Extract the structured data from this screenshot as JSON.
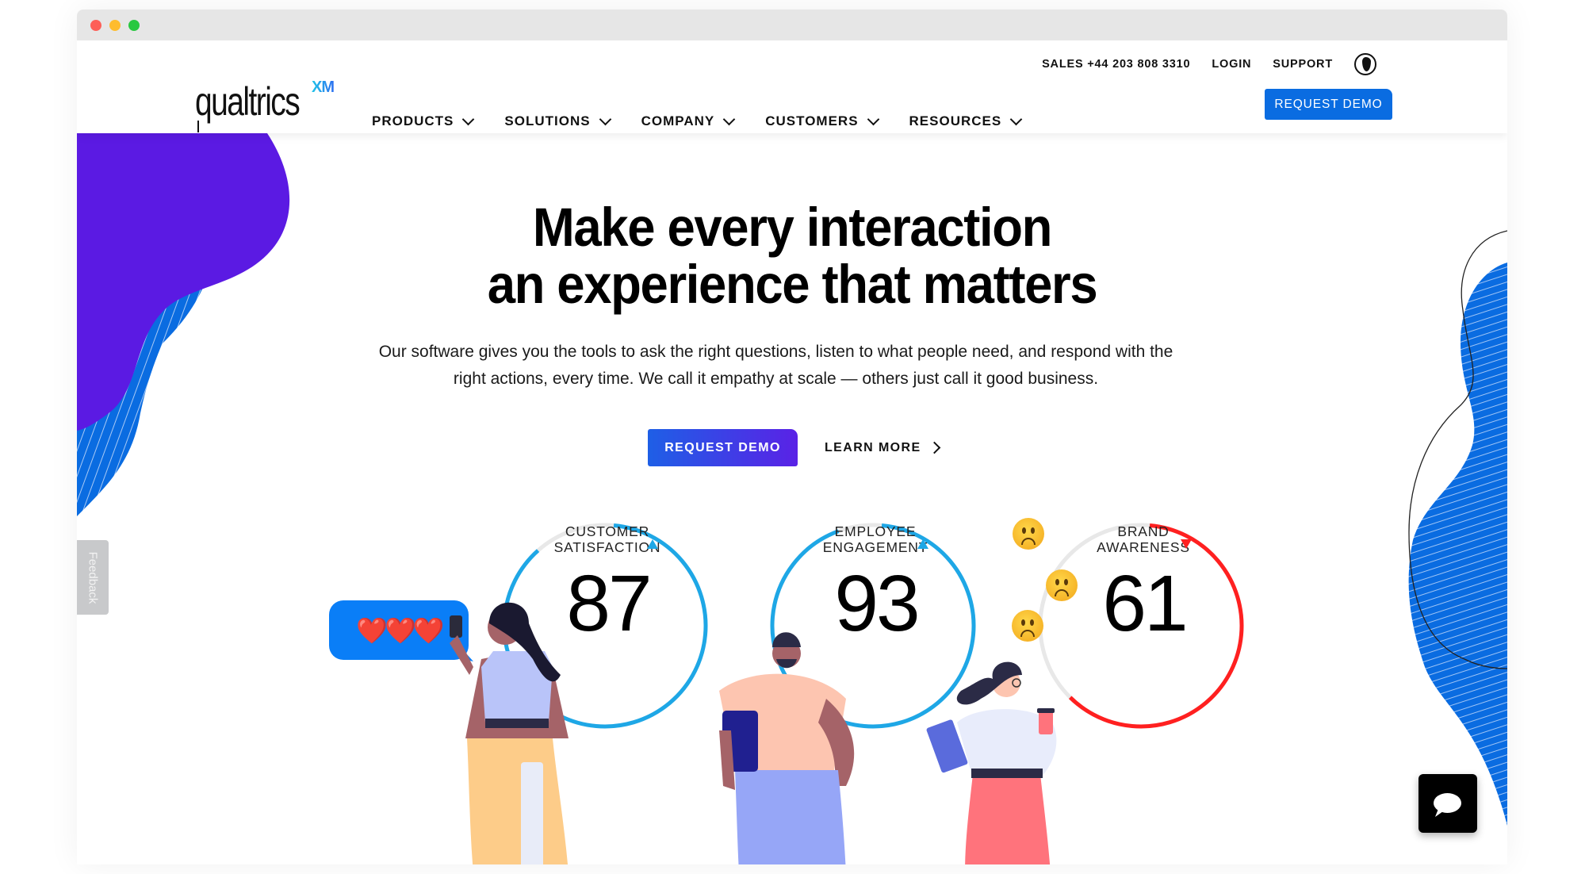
{
  "window": {
    "controls": [
      "close",
      "minimize",
      "maximize"
    ]
  },
  "header": {
    "logo_text": "qualtrics",
    "logo_badge": "XM",
    "utility_links": [
      "SALES +44 203 808 3310",
      "LOGIN",
      "SUPPORT"
    ],
    "language_icon": "globe-icon",
    "nav": [
      {
        "label": "PRODUCTS"
      },
      {
        "label": "SOLUTIONS"
      },
      {
        "label": "COMPANY"
      },
      {
        "label": "CUSTOMERS"
      },
      {
        "label": "RESOURCES"
      }
    ],
    "request_demo_label": "REQUEST DEMO",
    "accent_color": "#0a6ce1"
  },
  "hero": {
    "title_line1": "Make every interaction",
    "title_line2": "an experience that matters",
    "subtitle": "Our software gives you the tools to ask the right questions, listen to what people need, and respond with the right actions, every time. We call it empathy at scale — others just call it good business.",
    "primary_cta": "REQUEST DEMO",
    "secondary_cta": "LEARN MORE"
  },
  "metrics": [
    {
      "label_line1": "CUSTOMER",
      "label_line2": "SATISFACTION",
      "value": "87",
      "score": 87,
      "trend": "up",
      "color": "#1ea7e6"
    },
    {
      "label_line1": "EMPLOYEE",
      "label_line2": "ENGAGEMENT",
      "value": "93",
      "score": 93,
      "trend": "up",
      "color": "#1ea7e6"
    },
    {
      "label_line1": "BRAND",
      "label_line2": "AWARENESS",
      "value": "61",
      "score": 61,
      "trend": "down",
      "color": "#ff2020"
    }
  ],
  "decor": {
    "message_bubble": "❤️❤️❤️",
    "sad_emoji_count": 3
  },
  "feedback_tab": "Feedback",
  "chat_button_icon": "chat-bubble-icon"
}
